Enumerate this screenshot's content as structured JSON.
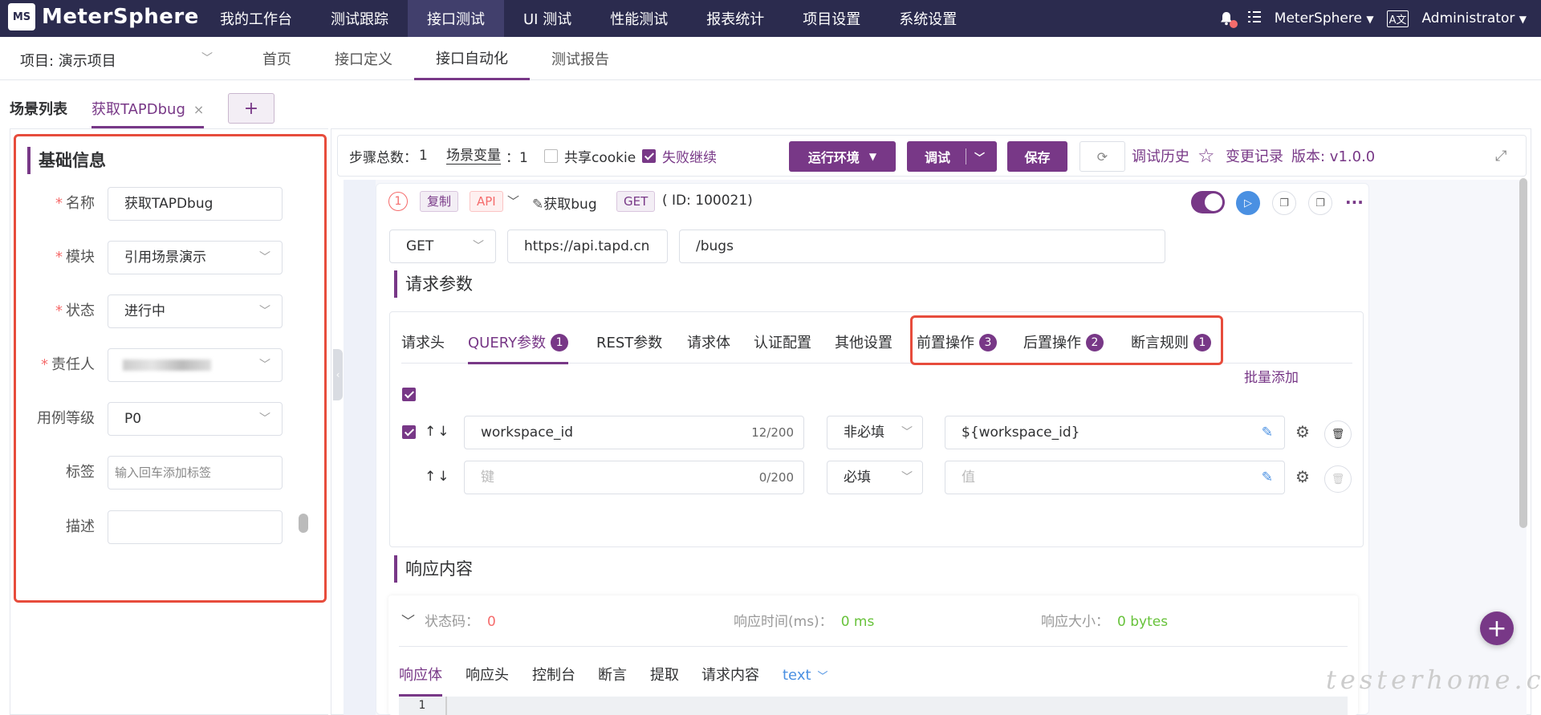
{
  "app": {
    "name": "MeterSphere",
    "logo_mark": "MS"
  },
  "topnav": {
    "items": [
      "我的工作台",
      "测试跟踪",
      "接口测试",
      "UI 测试",
      "性能测试",
      "报表统计",
      "项目设置",
      "系统设置"
    ],
    "active_index": 2,
    "workspace": "MeterSphere",
    "lang_icon": "A文",
    "user": "Administrator"
  },
  "project_bar": {
    "project_label": "项目: 演示项目",
    "subnav": [
      "首页",
      "接口定义",
      "接口自动化",
      "测试报告"
    ],
    "active_index": 2
  },
  "scenario_tabs": {
    "list_label": "场景列表",
    "current": "获取TAPDbug",
    "close": "×",
    "add": "+"
  },
  "basic_info": {
    "title": "基础信息",
    "fields": [
      {
        "label": "名称",
        "required": "*",
        "value": "获取TAPDbug"
      },
      {
        "label": "模块",
        "required": "*",
        "value": "引用场景演示"
      },
      {
        "label": "状态",
        "required": "*",
        "value": "进行中"
      },
      {
        "label": "责任人",
        "required": "*",
        "value": ""
      },
      {
        "label": "用例等级",
        "required": "",
        "value": "P0"
      },
      {
        "label": "标签",
        "required": "",
        "placeholder": "输入回车添加标签"
      },
      {
        "label": "描述",
        "required": "",
        "value": ""
      }
    ]
  },
  "toolbar": {
    "steps_label": "步骤总数：",
    "steps_value": "1",
    "vars_label": "场景变量",
    "vars_value": "：1",
    "share_cookie": "共享cookie",
    "fail_continue": "失败继续",
    "env_button": "运行环境",
    "debug_button": "调试",
    "save_button": "保存",
    "history": "调试历史",
    "changes": "变更记录",
    "version": "版本: v1.0.0"
  },
  "step": {
    "index": "1",
    "copy_tag": "复制",
    "api_tag": "API",
    "name": "获取bug",
    "method_tag": "GET",
    "id_text": "( ID: 100021)",
    "method": "GET",
    "domain": "https://api.tapd.cn",
    "path": "/bugs"
  },
  "request": {
    "title": "请求参数",
    "tabs": [
      {
        "label": "请求头",
        "badge": ""
      },
      {
        "label": "QUERY参数",
        "badge": "1"
      },
      {
        "label": "REST参数",
        "badge": ""
      },
      {
        "label": "请求体",
        "badge": ""
      },
      {
        "label": "认证配置",
        "badge": ""
      },
      {
        "label": "其他设置",
        "badge": ""
      },
      {
        "label": "前置操作",
        "badge": "3"
      },
      {
        "label": "后置操作",
        "badge": "2"
      },
      {
        "label": "断言规则",
        "badge": "1"
      }
    ],
    "active_tab": 1,
    "bulk_add": "批量添加",
    "rows": [
      {
        "key": "workspace_id",
        "key_placeholder": "",
        "counter": "12/200",
        "required": "非必填",
        "value": "${workspace_id}",
        "value_placeholder": ""
      },
      {
        "key": "",
        "key_placeholder": "键",
        "counter": "0/200",
        "required": "必填",
        "value": "",
        "value_placeholder": "值"
      }
    ],
    "sort_arrows": "↑↓"
  },
  "response": {
    "title": "响应内容",
    "status_label": "状态码：",
    "status_value": "0",
    "time_label": "响应时间(ms)：",
    "time_value": "0 ms",
    "size_label": "响应大小：",
    "size_value": "0 bytes",
    "tabs": [
      "响应体",
      "响应头",
      "控制台",
      "断言",
      "提取",
      "请求内容"
    ],
    "format": "text",
    "line_number": "1"
  },
  "watermark": "testerhome.com",
  "colors": {
    "brand": "#783887",
    "nav_bg": "#2b2b4e",
    "highlight": "#e74c3c",
    "success": "#67c23a",
    "danger": "#f56c6c"
  }
}
